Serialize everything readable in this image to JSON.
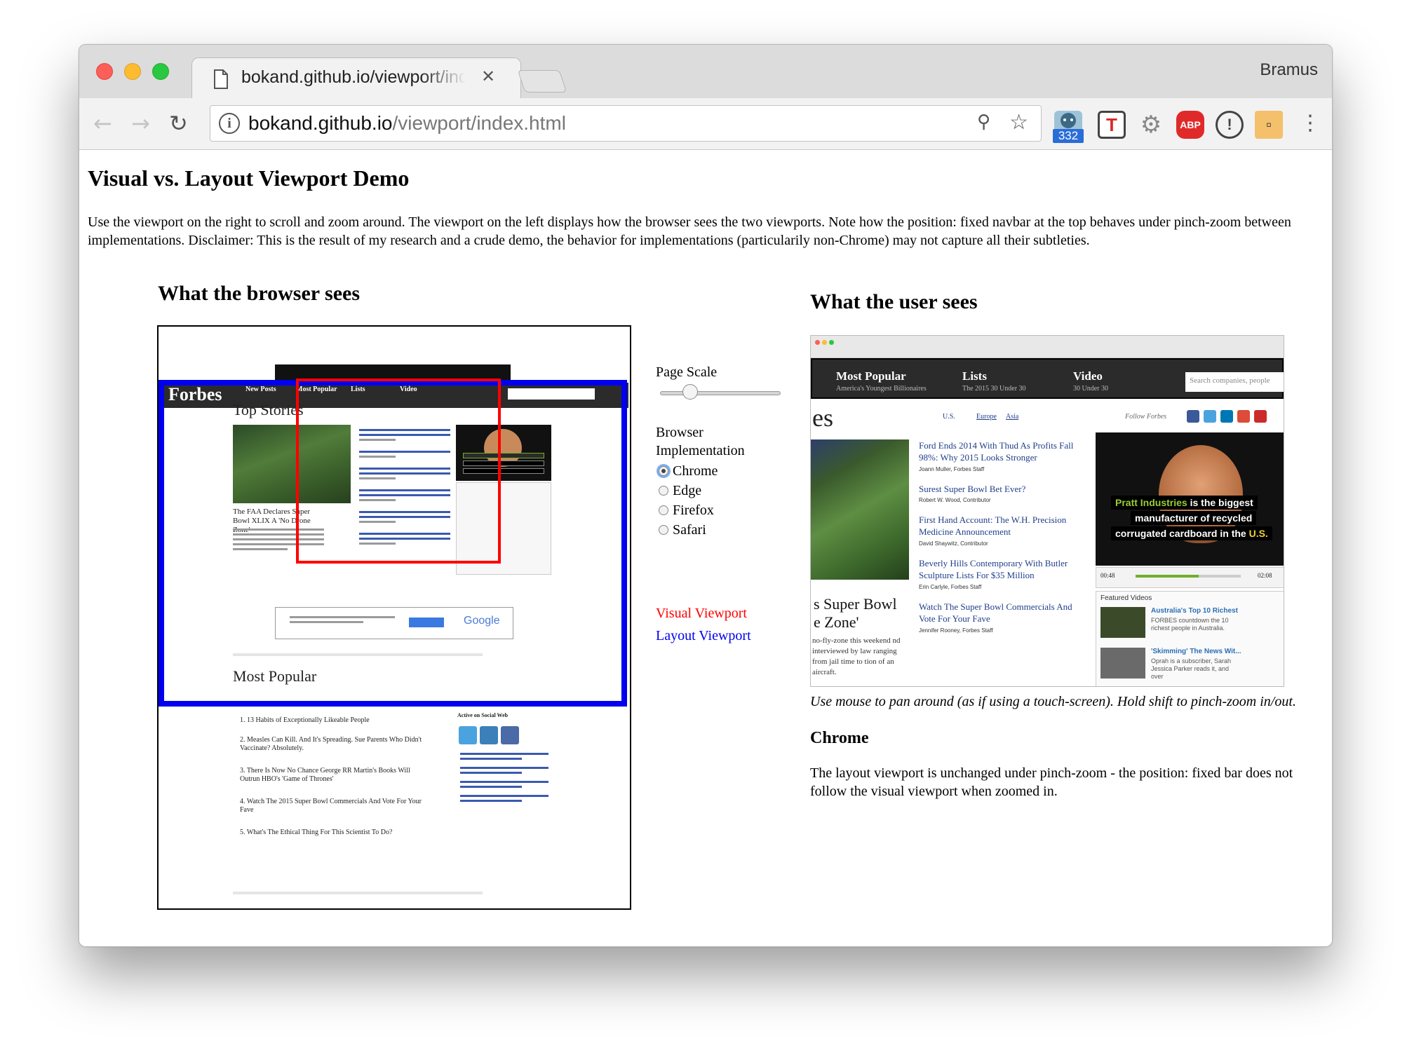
{
  "window": {
    "tab_title": "bokand.github.io/viewport/index.html",
    "profile_name": "Bramus",
    "url_host": "bokand.github.io",
    "url_path": "/viewport/index.html",
    "extension_badge": "332",
    "colors": {
      "close": "#fc5f57",
      "minimize": "#fdbc2e",
      "maximize": "#28c840"
    }
  },
  "page": {
    "title": "Visual vs. Layout Viewport Demo",
    "intro": "Use the viewport on the right to scroll and zoom around. The viewport on the left displays how the browser sees the two viewports. Note how the position: fixed navbar at the top behaves under pinch-zoom between implementations. Disclaimer: This is the result of my research and a crude demo, the behavior for implementations (particularily non-Chrome) may not capture all their subtleties.",
    "browser_heading": "What the browser sees",
    "user_heading": "What the user sees",
    "controls": {
      "page_scale_label": "Page Scale",
      "page_scale_value": 0.25,
      "implementation_label": "Browser Implementation",
      "implementations": [
        "Chrome",
        "Edge",
        "Firefox",
        "Safari"
      ],
      "selected": "Chrome"
    },
    "legend": {
      "visual": "Visual Viewport",
      "layout": "Layout Viewport",
      "visual_color": "#ff0000",
      "layout_color": "#0000ee"
    },
    "user_caption": "Use mouse to pan around (as if using a touch-screen). Hold shift to pinch-zoom in/out.",
    "impl_heading": "Chrome",
    "impl_description": "The layout viewport is unchanged under pinch-zoom - the position: fixed bar does not follow the visual viewport when zoomed in."
  },
  "thumbnail_browser": {
    "logo": "Forbes",
    "nav_items": [
      "New Posts",
      "Most Popular",
      "Lists",
      "Video"
    ],
    "section_top": "Top Stories",
    "headline_left": "The FAA Declares Super Bowl XLIX A 'No Drone Zone'",
    "section_popular": "Most Popular",
    "popular_items": [
      "1. 13 Habits of Exceptionally Likeable People",
      "2. Measles Can Kill. And It's Spreading. Sue Parents Who Didn't Vaccinate? Absolutely.",
      "3. There Is Now No Chance George RR Martin's Books Will Outrun HBO's 'Game of Thrones'",
      "4. Watch The 2015 Super Bowl Commercials And Vote For Your Fave",
      "5. What's The Ethical Thing For This Scientist To Do?"
    ],
    "social_heading": "Active on Social Web",
    "google_label": "Google"
  },
  "thumbnail_user": {
    "nav": [
      {
        "title": "Most Popular",
        "sub": "America's Youngest Billionaires"
      },
      {
        "title": "Lists",
        "sub": "The 2015 30 Under 30"
      },
      {
        "title": "Video",
        "sub": "30 Under 30"
      }
    ],
    "search_placeholder": "Search companies, people",
    "section_fragment": "es",
    "tags": [
      "U.S.",
      "Europe",
      "Asia"
    ],
    "follow": "Follow Forbes",
    "stories": [
      {
        "title": "Ford Ends 2014 With Thud As Profits Fall 98%: Why 2015 Looks Stronger",
        "author": "Joann Muller, Forbes Staff"
      },
      {
        "title": "Surest Super Bowl Bet Ever?",
        "author": "Robert W. Wood, Contributor"
      },
      {
        "title": "First Hand Account: The W.H. Precision Medicine Announcement",
        "author": "David Shaywitz, Contributor"
      },
      {
        "title": "Beverly Hills Contemporary With Butler Sculpture Lists For $35 Million",
        "author": "Erin Carlyle, Forbes Staff"
      },
      {
        "title": "Watch The Super Bowl Commercials And Vote For Your Fave",
        "author": "Jennifer Rooney, Forbes Staff"
      }
    ],
    "video_caption": [
      "Pratt Industries",
      "is the biggest",
      "manufacturer of recycled",
      "corrugated cardboard in the",
      "U.S."
    ],
    "time_start": "00:48",
    "time_end": "02:08",
    "featured_label": "Featured Videos",
    "featured": [
      {
        "title": "Australia's Top 10 Richest",
        "desc": "FORBES countdown the 10 richest people in Australia."
      },
      {
        "title": "'Skimming' The News Wit...",
        "desc": "Oprah is a subscriber, Sarah Jessica Parker reads it, and over"
      }
    ],
    "superbowl_fragment": [
      "s Super Bowl",
      "e Zone'"
    ],
    "para_fragment": "no-fly-zone this weekend nd interviewed by law ranging from jail time to tion of an aircraft."
  }
}
